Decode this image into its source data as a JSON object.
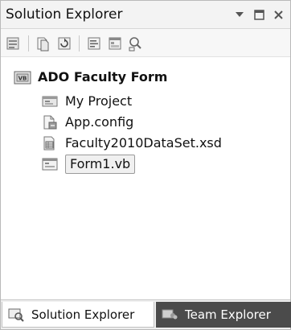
{
  "window": {
    "title": "Solution Explorer",
    "controls": [
      "dropdown-arrow-icon",
      "maximize-icon",
      "close-icon"
    ]
  },
  "toolbar": {
    "buttons": [
      "properties-icon",
      "show-all-files-icon",
      "refresh-icon",
      "view-code-icon",
      "view-designer-icon",
      "view-class-diagram-icon"
    ]
  },
  "tree": {
    "root": {
      "label": "ADO Faculty Form",
      "icon": "vb-project-icon"
    },
    "items": [
      {
        "label": "My Project",
        "icon": "my-project-icon"
      },
      {
        "label": "App.config",
        "icon": "config-file-icon"
      },
      {
        "label": "Faculty2010DataSet.xsd",
        "icon": "dataset-icon"
      },
      {
        "label": "Form1.vb",
        "icon": "form-icon",
        "selected": true
      }
    ]
  },
  "tabs": {
    "solution_explorer": {
      "label": "Solution Explorer",
      "icon": "solution-explorer-icon",
      "active": true
    },
    "team_explorer": {
      "label": "Team Explorer",
      "icon": "team-explorer-icon",
      "active": false
    }
  }
}
